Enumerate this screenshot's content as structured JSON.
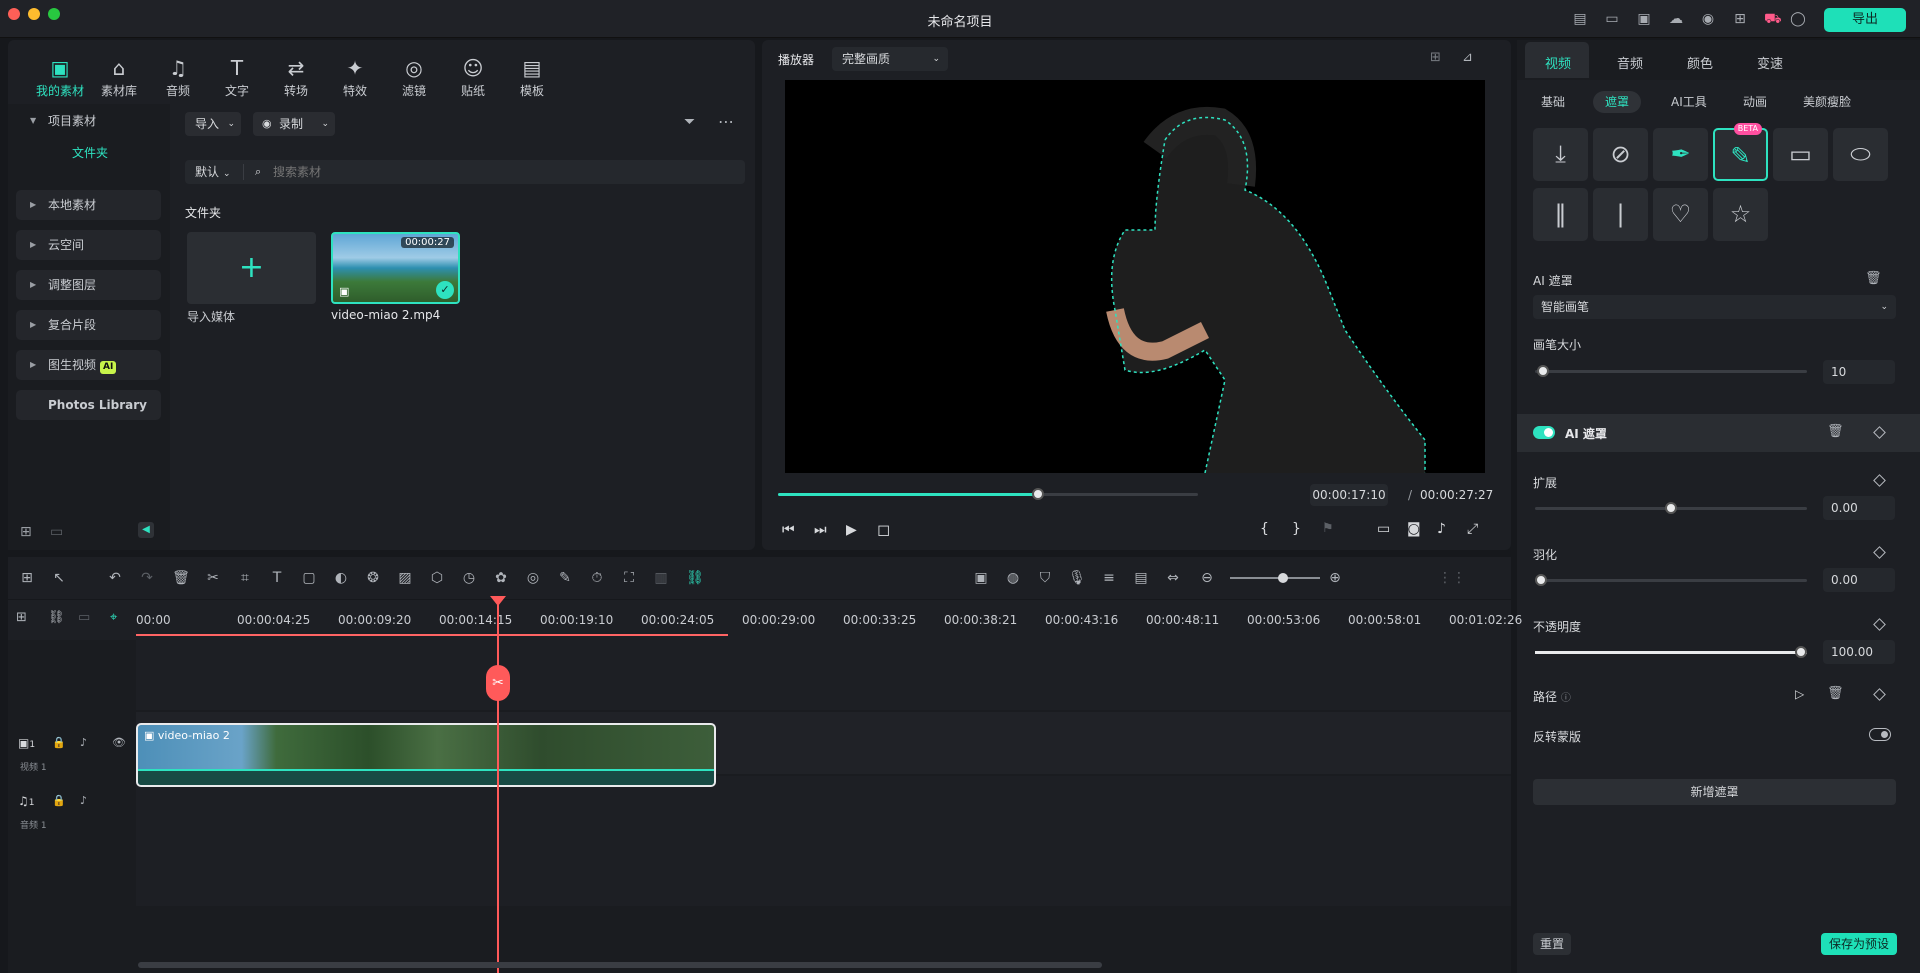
{
  "window": {
    "title": "未命名项目",
    "export_label": "导出"
  },
  "media": {
    "tools": [
      {
        "label": "我的素材",
        "icon": "▣"
      },
      {
        "label": "素材库",
        "icon": "⌂"
      },
      {
        "label": "音频",
        "icon": "♫"
      },
      {
        "label": "文字",
        "icon": "T"
      },
      {
        "label": "转场",
        "icon": "⇄"
      },
      {
        "label": "特效",
        "icon": "✦"
      },
      {
        "label": "滤镜",
        "icon": "◎"
      },
      {
        "label": "贴纸",
        "icon": "☺"
      },
      {
        "label": "模板",
        "icon": "▤"
      }
    ],
    "sidebar": {
      "project": "项目素材",
      "folder": "文件夹",
      "local": "本地素材",
      "cloud": "云空间",
      "adjust": "调整图层",
      "compound": "复合片段",
      "img2video": "图生视频",
      "ai_chip": "AI",
      "photos": "Photos Library"
    },
    "import_label": "导入",
    "record_label": "录制",
    "sort_label": "默认",
    "search_placeholder": "搜索素材",
    "section_title": "文件夹",
    "import_media_label": "导入媒体",
    "clip_name": "video-miao 2.mp4",
    "clip_duration": "00:00:27"
  },
  "player": {
    "label": "播放器",
    "quality": "完整画质",
    "current_time": "00:00:17:10",
    "total_time": "00:00:27:27",
    "progress": 0.62
  },
  "props": {
    "tabs": [
      "视频",
      "音频",
      "颜色",
      "变速"
    ],
    "subtabs": [
      "基础",
      "遮罩",
      "AI工具",
      "动画",
      "美颜瘦脸"
    ],
    "beta": "BETA",
    "ai_mask_title": "AI 遮罩",
    "ai_mask_mode": "智能画笔",
    "brush_size_label": "画笔大小",
    "brush_size": "10",
    "ai_mask_row": "AI 遮罩",
    "expand_label": "扩展",
    "expand_value": "0.00",
    "expand_level": 0.5,
    "feather_label": "羽化",
    "feather_value": "0.00",
    "feather_level": 0.0,
    "opacity_label": "不透明度",
    "opacity_value": "100.00",
    "opacity_level": 1.0,
    "path_label": "路径",
    "invert_label": "反转蒙版",
    "add_mask": "新增遮罩",
    "reset": "重置",
    "save_preset": "保存为预设"
  },
  "timeline": {
    "ticks": [
      "00:00",
      "00:00:04:25",
      "00:00:09:20",
      "00:00:14:15",
      "00:00:19:10",
      "00:00:24:05",
      "00:00:29:00",
      "00:00:33:25",
      "00:00:38:21",
      "00:00:43:16",
      "00:00:48:11",
      "00:00:53:06",
      "00:00:58:01",
      "00:01:02:26"
    ],
    "video_track": "视频 1",
    "audio_track": "音频 1",
    "clip_label": "video-miao 2",
    "track_num": "1"
  }
}
